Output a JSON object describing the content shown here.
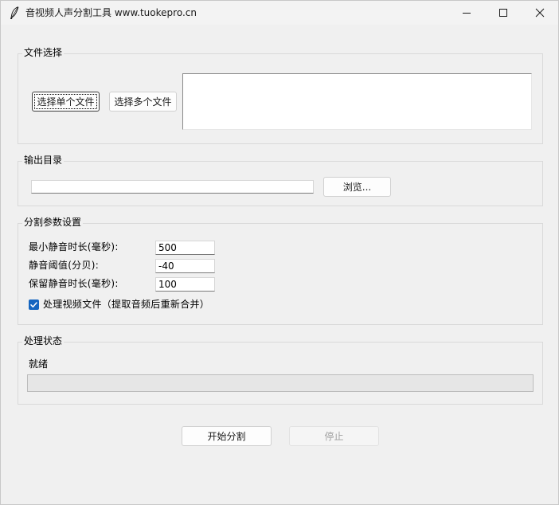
{
  "window": {
    "title": "音视频人声分割工具 www.tuokepro.cn",
    "icon": "feather-icon",
    "controls": [
      "minimize-icon",
      "maximize-icon",
      "close-icon"
    ]
  },
  "file_section": {
    "label": "文件选择",
    "single_button": "选择单个文件",
    "multi_button": "选择多个文件",
    "files": []
  },
  "output_section": {
    "label": "输出目录",
    "path_value": "",
    "browse_button": "浏览..."
  },
  "params_section": {
    "label": "分割参数设置",
    "min_silence_label": "最小静音时长(毫秒):",
    "min_silence_value": "500",
    "silence_thresh_label": "静音阈值(分贝):",
    "silence_thresh_value": "-40",
    "keep_silence_label": "保留静音时长(毫秒):",
    "keep_silence_value": "100",
    "process_video_label": "处理视频文件（提取音频后重新合并）",
    "process_video_checked": true,
    "checkbox_color": "#1565c0"
  },
  "status_section": {
    "label": "处理状态",
    "status_text": "就绪",
    "progress": 0
  },
  "actions": {
    "start_button": "开始分割",
    "stop_button": "停止",
    "stop_disabled": true
  }
}
